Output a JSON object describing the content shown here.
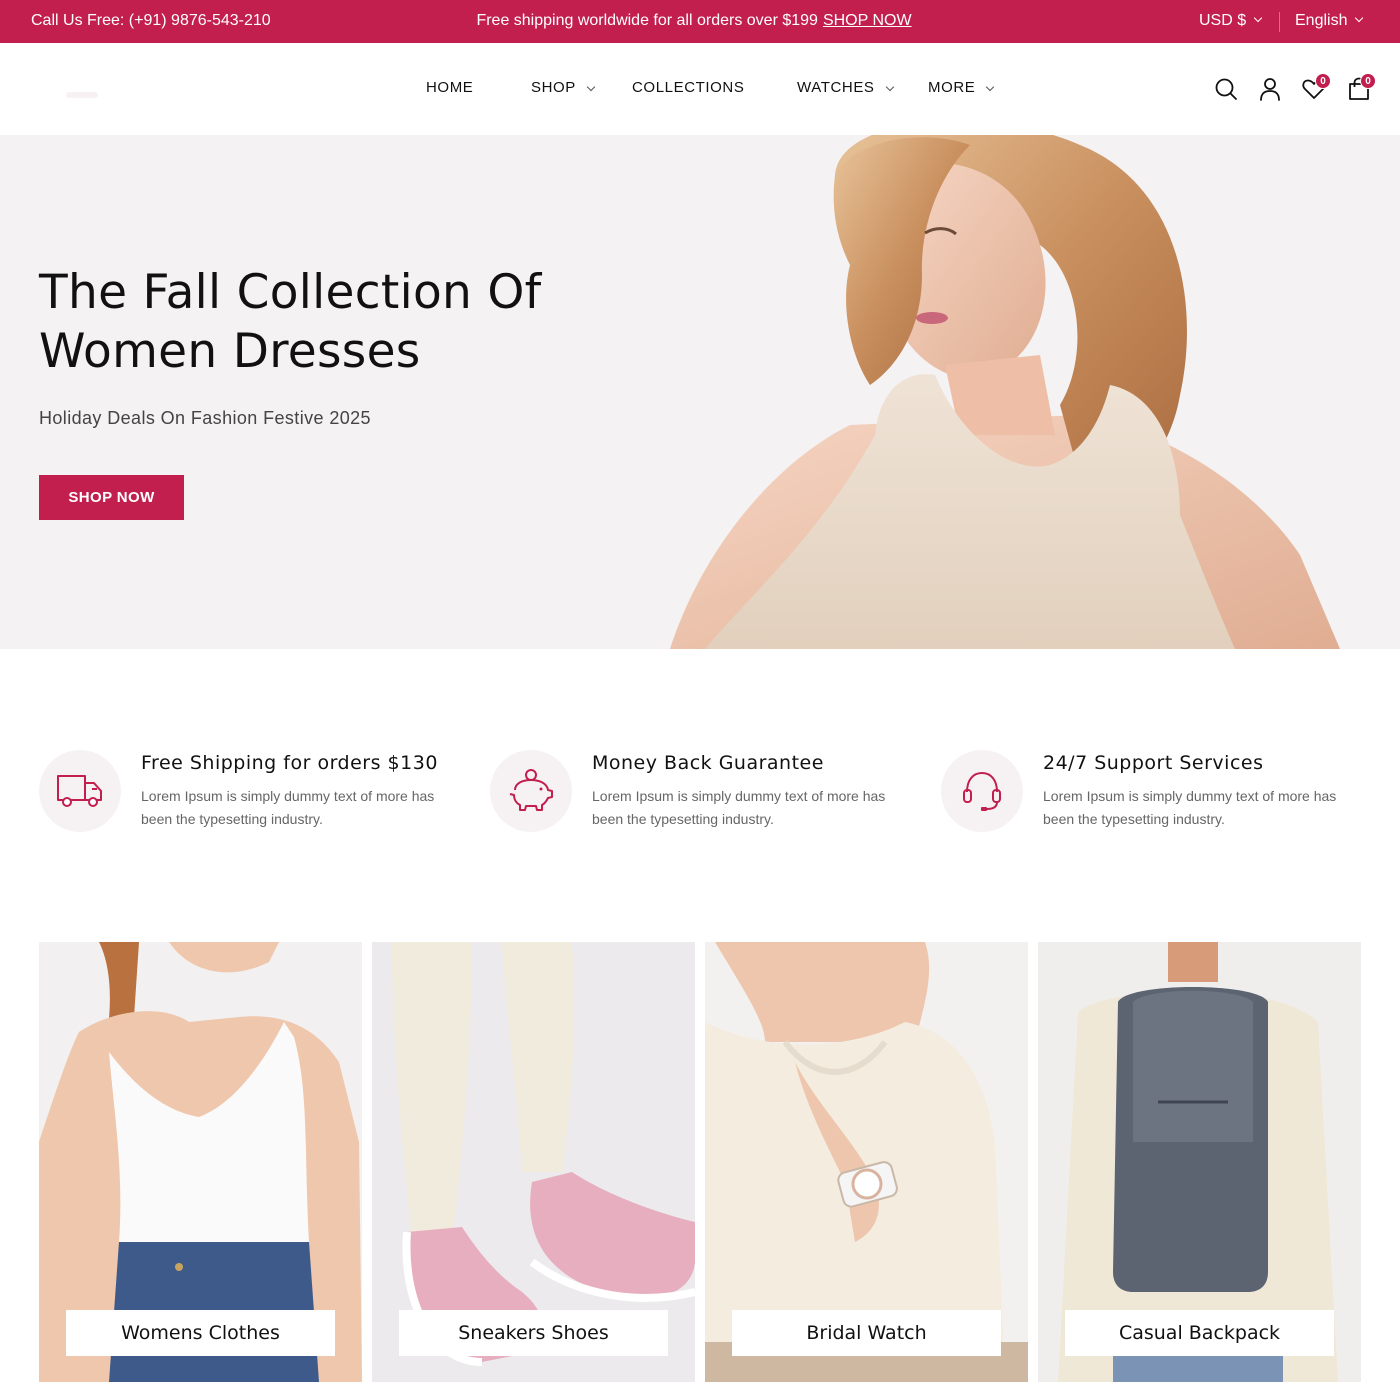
{
  "topbar": {
    "phone": "Call Us Free: (+91) 9876-543-210",
    "promo_text": "Free shipping worldwide for all orders over $199",
    "promo_link": "SHOP NOW",
    "currency": "USD $",
    "language": "English"
  },
  "nav": {
    "items": [
      {
        "label": "HOME"
      },
      {
        "label": "SHOP"
      },
      {
        "label": "COLLECTIONS"
      },
      {
        "label": "WATCHES"
      },
      {
        "label": "MORE"
      }
    ]
  },
  "header": {
    "wishlist_count": "0",
    "cart_count": "0"
  },
  "hero": {
    "title_line1": "The Fall Collection Of",
    "title_line2": "Women Dresses",
    "subtitle": "Holiday Deals On Fashion Festive 2025",
    "cta": "SHOP NOW"
  },
  "features": [
    {
      "icon": "truck-icon",
      "title": "Free Shipping for orders $130",
      "desc": "Lorem Ipsum is simply dummy text of more has been the typesetting industry."
    },
    {
      "icon": "piggy-bank-icon",
      "title": "Money Back Guarantee",
      "desc": "Lorem Ipsum is simply dummy text of more has been the typesetting industry."
    },
    {
      "icon": "headset-icon",
      "title": "24/7 Support Services",
      "desc": "Lorem Ipsum is simply dummy text of more has been the typesetting industry."
    }
  ],
  "categories": [
    {
      "label": "Womens Clothes"
    },
    {
      "label": "Sneakers Shoes"
    },
    {
      "label": "Bridal Watch"
    },
    {
      "label": "Casual Backpack"
    }
  ],
  "colors": {
    "accent": "#c21e4e",
    "hero_bg": "#f4f2f3",
    "icon_circle": "#f6f2f4"
  }
}
